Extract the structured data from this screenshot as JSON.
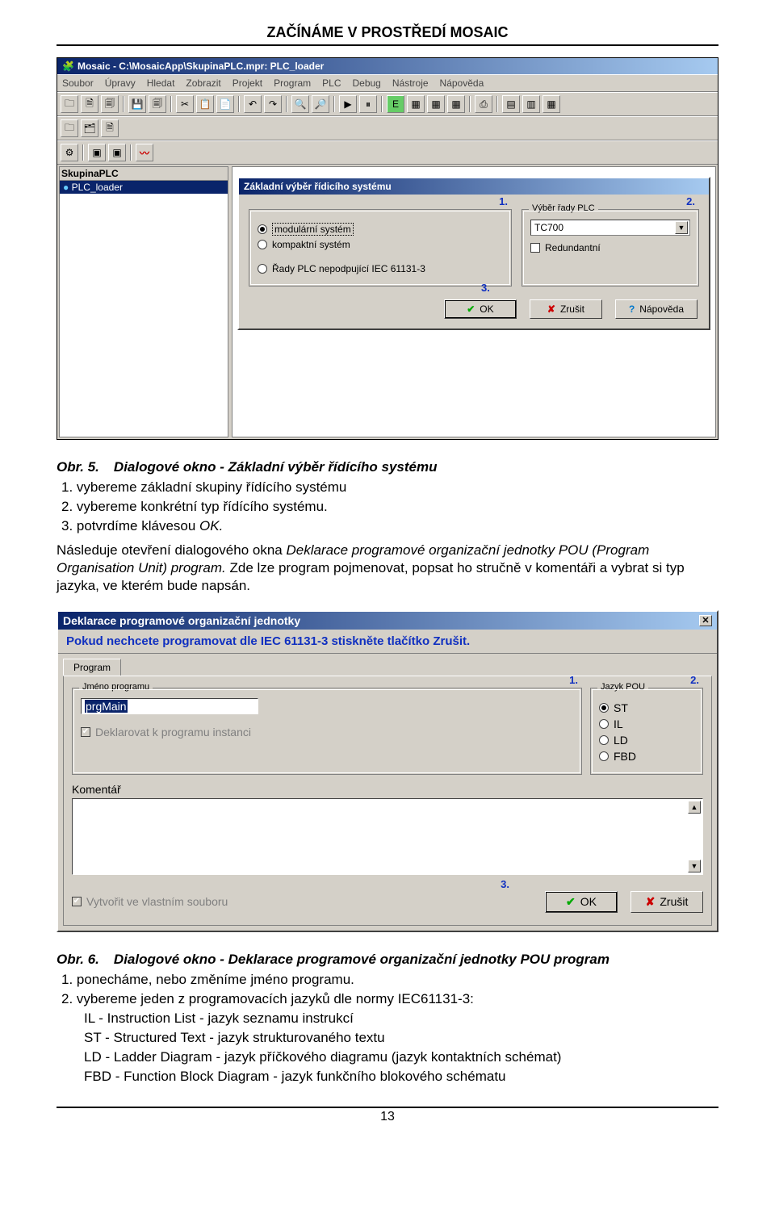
{
  "doc": {
    "header_title": "ZAČÍNÁME V PROSTŘEDÍ MOSAIC",
    "page_number": "13"
  },
  "ide": {
    "title": "Mosaic - C:\\MosaicApp\\SkupinaPLC.mpr: PLC_loader",
    "menu": [
      "Soubor",
      "Úpravy",
      "Hledat",
      "Zobrazit",
      "Projekt",
      "Program",
      "PLC",
      "Debug",
      "Nástroje",
      "Nápověda"
    ],
    "tree_header": "SkupinaPLC",
    "tree_item": "PLC_loader"
  },
  "dlg1": {
    "title": "Základní výběr řídicího systému",
    "radio1": "modulární systém",
    "radio2": "kompaktní systém",
    "radio3": "Řady PLC nepodpující IEC 61131-3",
    "group_right_legend": "Výběr řady PLC",
    "select_value": "TC700",
    "chk_redundant": "Redundantní",
    "btn_ok": "OK",
    "btn_cancel": "Zrušit",
    "btn_help": "Nápověda",
    "callout1": "1.",
    "callout2": "2.",
    "callout3": "3."
  },
  "cap1": {
    "label": "Obr. 5.",
    "text": "Dialogové okno - Základní výběr řídícího systému"
  },
  "list1": {
    "i1": "1. vybereme základní skupiny řídícího systému",
    "i2": "2. vybereme konkrétní typ řídícího systému.",
    "i3_a": "3. potvrdíme klávesou ",
    "i3_b": "OK."
  },
  "para1": {
    "a": "Následuje otevření dialogového okna ",
    "b": "Deklarace programové organizační jednotky POU (Program Organisation Unit) program.",
    "c": " Zde lze program pojmenovat, popsat ho stručně v komentáři a vybrat si typ jazyka, ve kterém bude napsán."
  },
  "dlg2": {
    "title": "Deklarace programové organizační jednotky",
    "hint": "Pokud nechcete programovat dle IEC 61131-3 stiskněte tlačítko Zrušit.",
    "tab": "Program",
    "name_legend": "Jméno programu",
    "name_value": "prgMain",
    "chk_decl": "Deklarovat k programu instanci",
    "comment_label": "Komentář",
    "lang_legend": "Jazyk POU",
    "lang_st": "ST",
    "lang_il": "IL",
    "lang_ld": "LD",
    "lang_fbd": "FBD",
    "chk_own": "Vytvořit ve vlastním souboru",
    "btn_ok": "OK",
    "btn_cancel": "Zrušit",
    "callout1": "1.",
    "callout2": "2.",
    "callout3": "3."
  },
  "cap2": {
    "label": "Obr. 6.",
    "text": "Dialogové okno - Deklarace programové organizační jednotky POU program"
  },
  "list2": {
    "i1": "1. ponecháme, nebo změníme jméno programu.",
    "i2": "2. vybereme jeden z programovacích jazyků dle normy IEC61131-3:",
    "sub_il": "IL - Instruction List - jazyk seznamu instrukcí",
    "sub_st": "ST - Structured Text - jazyk strukturovaného textu",
    "sub_ld": "LD - Ladder Diagram - jazyk příčkového diagramu (jazyk kontaktních schémat)",
    "sub_fbd": "FBD - Function Block Diagram - jazyk funkčního blokového schématu"
  }
}
